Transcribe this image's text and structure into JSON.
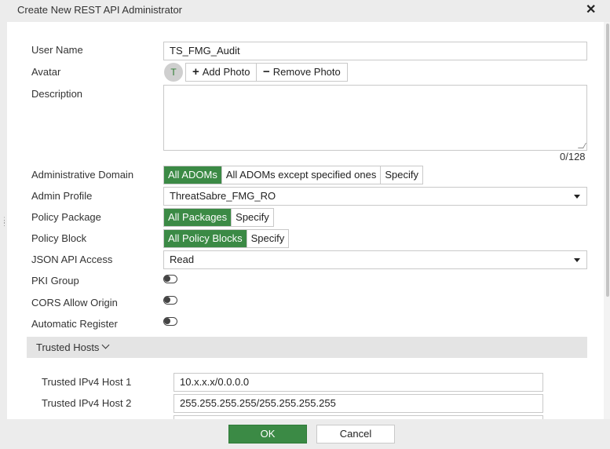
{
  "dialog": {
    "title": "Create New REST API Administrator",
    "close_icon": "close-icon"
  },
  "form": {
    "user_name": {
      "label": "User Name",
      "value": "TS_FMG_Audit"
    },
    "avatar": {
      "label": "Avatar",
      "initial": "T",
      "add_label": "Add Photo",
      "remove_label": "Remove Photo"
    },
    "description": {
      "label": "Description",
      "value": "",
      "counter": "0/128"
    },
    "admin_domain": {
      "label": "Administrative Domain",
      "options": [
        "All ADOMs",
        "All ADOMs except specified ones",
        "Specify"
      ],
      "selected": "All ADOMs"
    },
    "admin_profile": {
      "label": "Admin Profile",
      "value": "ThreatSabre_FMG_RO"
    },
    "policy_package": {
      "label": "Policy Package",
      "options": [
        "All Packages",
        "Specify"
      ],
      "selected": "All Packages"
    },
    "policy_block": {
      "label": "Policy Block",
      "options": [
        "All Policy Blocks",
        "Specify"
      ],
      "selected": "All Policy Blocks"
    },
    "json_api_access": {
      "label": "JSON API Access",
      "value": "Read"
    },
    "pki_group": {
      "label": "PKI Group",
      "enabled": false
    },
    "cors_allow_origin": {
      "label": "CORS Allow Origin",
      "enabled": false
    },
    "automatic_register": {
      "label": "Automatic Register",
      "enabled": false
    }
  },
  "trusted_hosts": {
    "section_label": "Trusted Hosts",
    "hosts": [
      {
        "label": "Trusted IPv4 Host 1",
        "value": "10.x.x.x/0.0.0.0"
      },
      {
        "label": "Trusted IPv4 Host 2",
        "value": "255.255.255.255/255.255.255.255"
      }
    ]
  },
  "footer": {
    "ok_label": "OK",
    "cancel_label": "Cancel"
  },
  "colors": {
    "accent": "#3b8a45",
    "border": "#c9c9c9",
    "section_bg": "#e4e4e4"
  }
}
